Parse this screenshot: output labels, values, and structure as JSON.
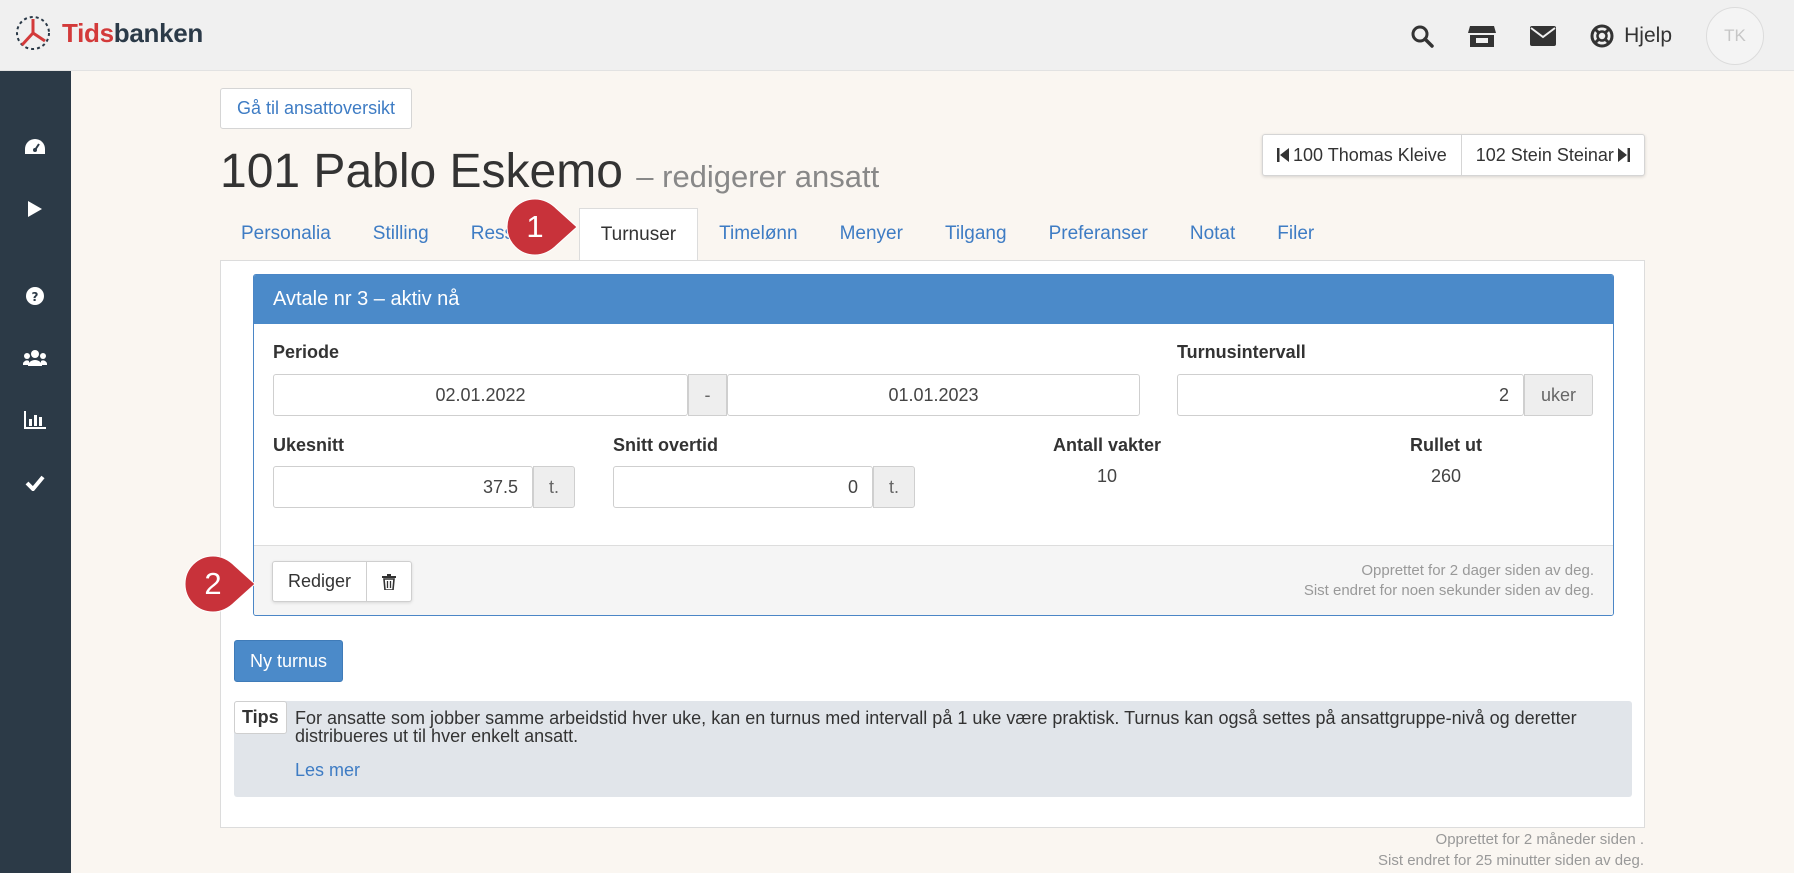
{
  "app": {
    "logo_red": "Tids",
    "logo_dark": "banken",
    "icons": [
      "search-icon",
      "store-icon",
      "envelope-icon",
      "lifebuoy-icon"
    ],
    "help_label": "Hjelp",
    "avatar_initials": "TK"
  },
  "sidebar": {
    "icons": [
      "dashboard-icon",
      "play-icon",
      "question-circle-icon",
      "users-icon",
      "bar-chart-icon",
      "check-icon"
    ]
  },
  "header": {
    "back_button": "Gå til ansattoversikt",
    "employee_title": "101 Pablo Eskemo",
    "subtitle": "– redigerer ansatt",
    "prev_employee": "100 Thomas Kleive",
    "next_employee": "102 Stein Steinar"
  },
  "tabs": [
    {
      "label": "Personalia",
      "active": false
    },
    {
      "label": "Stilling",
      "active": false
    },
    {
      "label": "Ressu",
      "active": false
    },
    {
      "label": "Turnuser",
      "active": true
    },
    {
      "label": "Timelønn",
      "active": false
    },
    {
      "label": "Menyer",
      "active": false
    },
    {
      "label": "Tilgang",
      "active": false
    },
    {
      "label": "Preferanser",
      "active": false
    },
    {
      "label": "Notat",
      "active": false
    },
    {
      "label": "Filer",
      "active": false
    }
  ],
  "agreement": {
    "header": "Avtale nr 3 – aktiv nå",
    "period_label": "Periode",
    "period_from": "02.01.2022",
    "period_separator": "-",
    "period_to": "01.01.2023",
    "interval_label": "Turnusintervall",
    "interval_value": "2",
    "interval_unit": "uker",
    "weekly_avg_label": "Ukesnitt",
    "weekly_avg_value": "37.5",
    "weekly_avg_unit": "t.",
    "overtime_label": "Snitt overtid",
    "overtime_value": "0",
    "overtime_unit": "t.",
    "shifts_label": "Antall vakter",
    "shifts_value": "10",
    "rolled_out_label": "Rullet ut",
    "rolled_out_value": "260",
    "edit_button": "Rediger",
    "created_text": "Opprettet for 2 dager siden av deg.",
    "modified_text": "Sist endret for noen sekunder siden av deg."
  },
  "new_button": "Ny turnus",
  "tips": {
    "label": "Tips",
    "text": "For ansatte som jobber samme arbeidstid hver uke, kan en turnus med intervall på 1 uke være praktisk. Turnus kan også settes på ansattgruppe-nivå og deretter distribueres ut til hver enkelt ansatt.",
    "link": "Les mer"
  },
  "footer": {
    "created_text": "Opprettet for 2 måneder siden .",
    "modified_text": "Sist endret for 25 minutter siden av deg."
  },
  "callouts": [
    "1",
    "2"
  ],
  "colors": {
    "accent": "#4b8ac9",
    "link": "#3e7cc4",
    "sidebar": "#2c3a47",
    "callout": "#c8323a",
    "logo_red": "#d33a3a"
  }
}
